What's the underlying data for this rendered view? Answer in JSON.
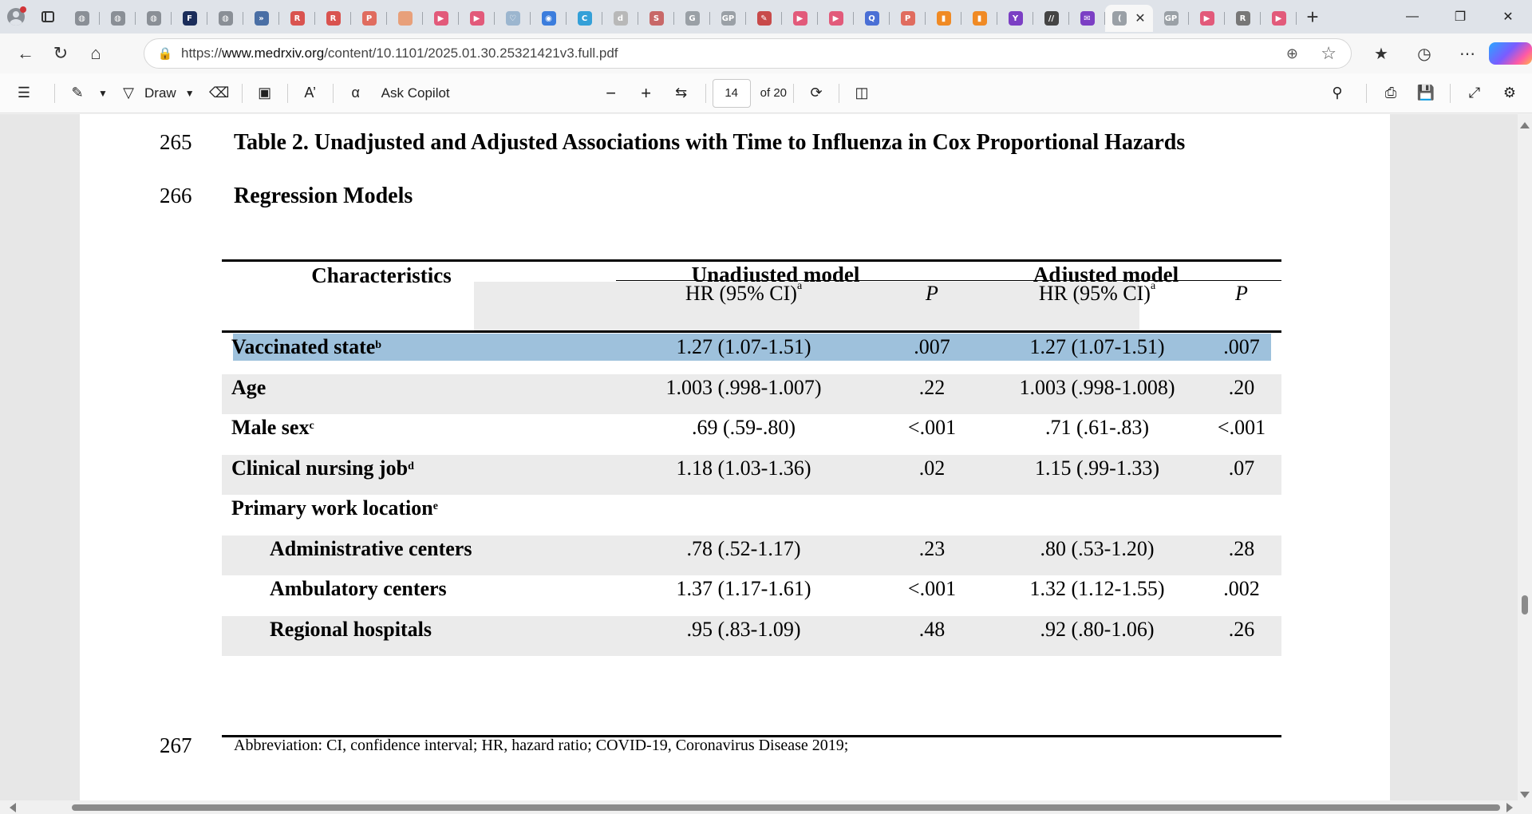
{
  "browser": {
    "tabs": [
      {
        "icon": "globe-icon",
        "color": "#8a8f96",
        "glyph": "◍"
      },
      {
        "icon": "globe-icon",
        "color": "#8a8f96",
        "glyph": "◍"
      },
      {
        "icon": "globe-icon",
        "color": "#8a8f96",
        "glyph": "◍"
      },
      {
        "icon": "fox-news-icon",
        "color": "#1b2d5a",
        "glyph": "F"
      },
      {
        "icon": "globe-icon",
        "color": "#8a8f96",
        "glyph": "◍"
      },
      {
        "icon": "arrow-icon",
        "color": "#4a6fa5",
        "glyph": "»"
      },
      {
        "icon": "r-icon",
        "color": "#d9534f",
        "glyph": "R"
      },
      {
        "icon": "r-icon",
        "color": "#d9534f",
        "glyph": "R"
      },
      {
        "icon": "pdf-icon",
        "color": "#e06c5f",
        "glyph": "P"
      },
      {
        "icon": "circle-icon",
        "color": "#e8a07a",
        "glyph": ""
      },
      {
        "icon": "youtube-icon",
        "color": "#e25a7a",
        "glyph": "▶"
      },
      {
        "icon": "youtube-icon",
        "color": "#e25a7a",
        "glyph": "▶"
      },
      {
        "icon": "heart-icon",
        "color": "#9cb6cf",
        "glyph": "♡"
      },
      {
        "icon": "chrome-icon",
        "color": "#3b7ddd",
        "glyph": "◉"
      },
      {
        "icon": "c-icon",
        "color": "#34a0d8",
        "glyph": "C"
      },
      {
        "icon": "doc-icon",
        "color": "#b8b8b8",
        "glyph": "d"
      },
      {
        "icon": "s-icon",
        "color": "#c86868",
        "glyph": "S"
      },
      {
        "icon": "google-icon",
        "color": "#9aa0a6",
        "glyph": "G"
      },
      {
        "icon": "gp-icon",
        "color": "#9aa0a6",
        "glyph": "GP"
      },
      {
        "icon": "pen-icon",
        "color": "#c84a4a",
        "glyph": "✎"
      },
      {
        "icon": "youtube-icon",
        "color": "#e25a7a",
        "glyph": "▶"
      },
      {
        "icon": "youtube-icon",
        "color": "#e25a7a",
        "glyph": "▶"
      },
      {
        "icon": "q-icon",
        "color": "#4a6fd5",
        "glyph": "Q"
      },
      {
        "icon": "pdf-icon",
        "color": "#e06c5f",
        "glyph": "P"
      },
      {
        "icon": "bookmark-icon",
        "color": "#f08a24",
        "glyph": "▮"
      },
      {
        "icon": "bookmark-icon",
        "color": "#f08a24",
        "glyph": "▮"
      },
      {
        "icon": "y-icon",
        "color": "#7b3fc4",
        "glyph": "Y"
      },
      {
        "icon": "slash-icon",
        "color": "#444444",
        "glyph": "//"
      },
      {
        "icon": "mail-icon",
        "color": "#7b3fc4",
        "glyph": "✉"
      },
      {
        "icon": "active-tab-icon",
        "color": "#9aa0a6",
        "glyph": "(",
        "active": true
      },
      {
        "icon": "gp-icon",
        "color": "#9aa0a6",
        "glyph": "GP"
      },
      {
        "icon": "youtube-icon",
        "color": "#e25a7a",
        "glyph": "▶"
      },
      {
        "icon": "r-icon",
        "color": "#777777",
        "glyph": "R"
      },
      {
        "icon": "youtube-icon",
        "color": "#e25a7a",
        "glyph": "▶"
      }
    ],
    "url_prefix": "https://",
    "url_host": "www.medrxiv.org",
    "url_path": "/content/10.1101/2025.01.30.25321421v3.full.pdf"
  },
  "pdf_toolbar": {
    "draw_label": "Draw",
    "ask_copilot_label": "Ask Copilot",
    "page_number": "14",
    "page_total": "of 20"
  },
  "document": {
    "line_numbers": {
      "l265": "265",
      "l266": "266",
      "l267": "267"
    },
    "caption_line1": "Table 2. Unadjusted and Adjusted Associations with Time to Influenza in Cox Proportional Hazards",
    "caption_line2": "Regression Models",
    "table": {
      "headers": {
        "characteristics": "Characteristics",
        "unadjusted": "Unadjusted model",
        "adjusted": "Adjusted model"
      },
      "subheaders": {
        "hr": "HR (95% CI)",
        "hr_sup": "a",
        "p": "P"
      },
      "rows": [
        {
          "label": "Vaccinated state",
          "sup": "b",
          "u_hr": "1.27 (1.07-1.51)",
          "u_p": ".007",
          "a_hr": "1.27 (1.07-1.51)",
          "a_p": ".007",
          "indent": false,
          "highlight": true
        },
        {
          "label": "Age",
          "sup": "",
          "u_hr": "1.003 (.998-1.007)",
          "u_p": ".22",
          "a_hr": "1.003 (.998-1.008)",
          "a_p": ".20",
          "indent": false
        },
        {
          "label": "Male sex",
          "sup": "c",
          "u_hr": ".69 (.59-.80)",
          "u_p": "<.001",
          "a_hr": ".71 (.61-.83)",
          "a_p": "<.001",
          "indent": false
        },
        {
          "label": "Clinical nursing job",
          "sup": "d",
          "u_hr": "1.18 (1.03-1.36)",
          "u_p": ".02",
          "a_hr": "1.15 (.99-1.33)",
          "a_p": ".07",
          "indent": false
        },
        {
          "label": "Primary work location",
          "sup": "e",
          "u_hr": "",
          "u_p": "",
          "a_hr": "",
          "a_p": "",
          "indent": false
        },
        {
          "label": "Administrative centers",
          "sup": "",
          "u_hr": ".78 (.52-1.17)",
          "u_p": ".23",
          "a_hr": ".80 (.53-1.20)",
          "a_p": ".28",
          "indent": true
        },
        {
          "label": "Ambulatory centers",
          "sup": "",
          "u_hr": "1.37 (1.17-1.61)",
          "u_p": "<.001",
          "a_hr": "1.32 (1.12-1.55)",
          "a_p": ".002",
          "indent": true
        },
        {
          "label": "Regional hospitals",
          "sup": "",
          "u_hr": ".95 (.83-1.09)",
          "u_p": ".48",
          "a_hr": ".92 (.80-1.06)",
          "a_p": ".26",
          "indent": true
        }
      ]
    },
    "footnote": "Abbreviation: CI, confidence interval; HR, hazard ratio; COVID-19, Coronavirus Disease 2019;"
  }
}
